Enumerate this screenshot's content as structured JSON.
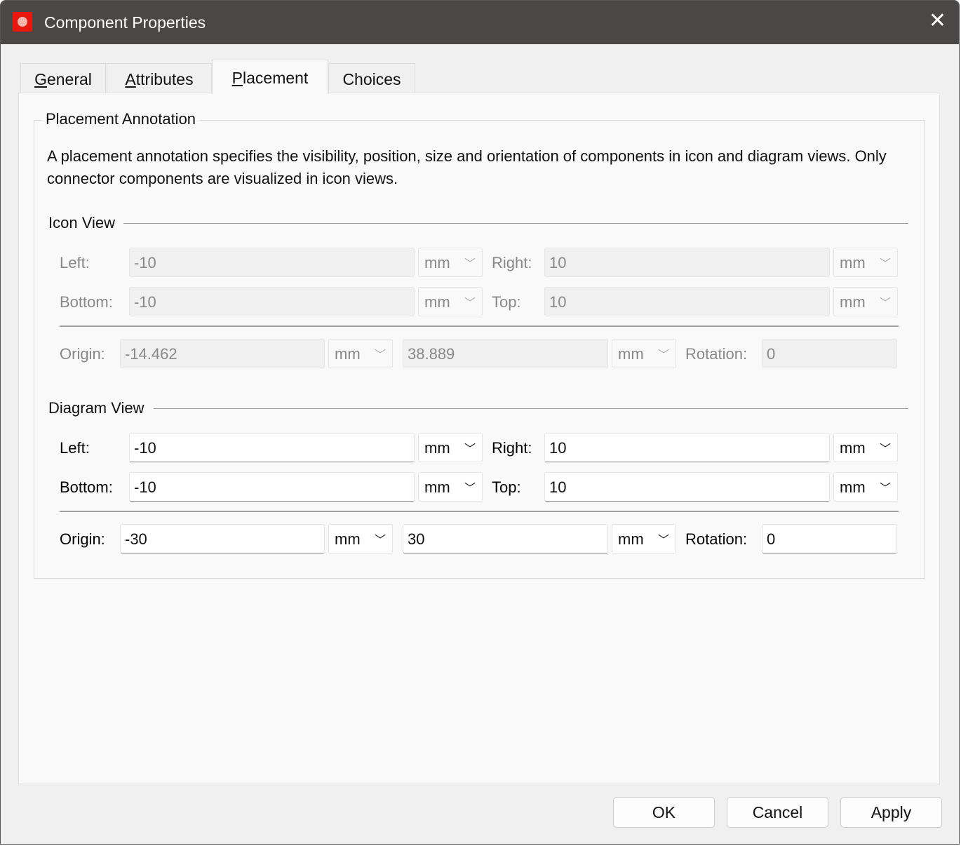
{
  "window": {
    "title": "Component Properties",
    "icon": "app-logo-icon",
    "close_icon": "close-icon"
  },
  "tabs": [
    {
      "label": "General",
      "mn": "G",
      "rest": "eneral"
    },
    {
      "label": "Attributes",
      "mn": "A",
      "rest": "ttributes"
    },
    {
      "label": "Placement",
      "mn": "P",
      "rest": "lacement",
      "active": true
    },
    {
      "label": "Choices",
      "mn": "",
      "rest": "Choices"
    }
  ],
  "group": {
    "title": "Placement Annotation",
    "description": "A placement annotation specifies the visibility, position, size and orientation of components in icon and diagram views. Only connector components are visualized in icon views."
  },
  "icon_view": {
    "title": "Icon View",
    "enabled": false,
    "left": "-10",
    "left_unit": "mm",
    "right": "10",
    "right_unit": "mm",
    "bottom": "-10",
    "bottom_unit": "mm",
    "top": "10",
    "top_unit": "mm",
    "origin_x": "-14.462",
    "origin_x_unit": "mm",
    "origin_y": "38.889",
    "origin_y_unit": "mm",
    "rotation": "0"
  },
  "diagram_view": {
    "title": "Diagram View",
    "enabled": true,
    "left": "-10",
    "left_unit": "mm",
    "right": "10",
    "right_unit": "mm",
    "bottom": "-10",
    "bottom_unit": "mm",
    "top": "10",
    "top_unit": "mm",
    "origin_x": "-30",
    "origin_x_unit": "mm",
    "origin_y": "30",
    "origin_y_unit": "mm",
    "rotation": "0"
  },
  "labels": {
    "left": "Left:",
    "right": "Right:",
    "bottom": "Bottom:",
    "top": "Top:",
    "origin": "Origin:",
    "rotation": "Rotation:"
  },
  "buttons": {
    "ok": "OK",
    "cancel": "Cancel",
    "apply": "Apply"
  }
}
